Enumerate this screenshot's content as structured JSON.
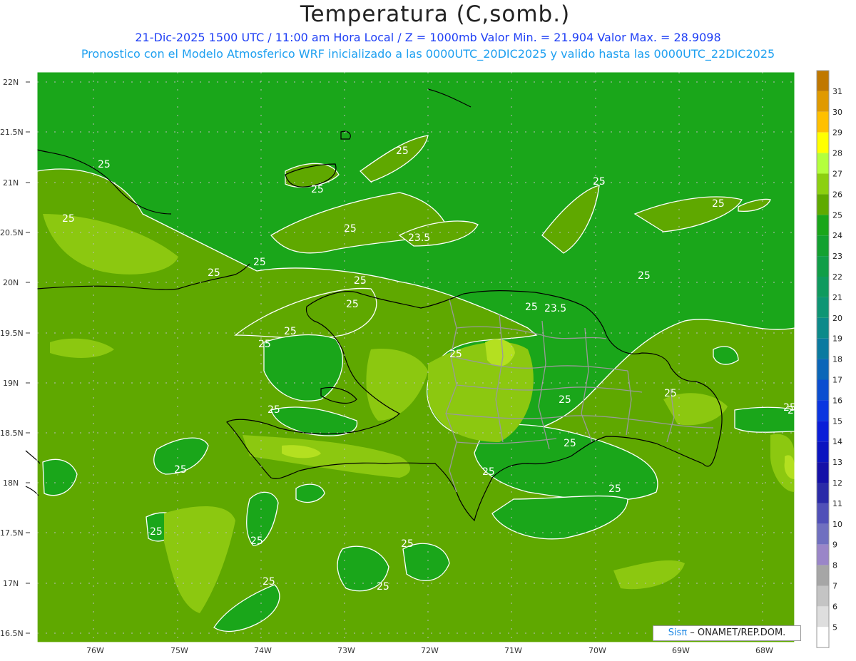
{
  "header": {
    "title": "Temperatura (C,somb.)",
    "line1": "21-Dic-2025 1500 UTC / 11:00 am Hora Local / Z = 1000mb   Valor Min. = 21.904  Valor Max. = 28.9098",
    "line2": "Pronostico con el Modelo Atmosferico WRF inicializado a las 0000UTC_20DIC2025 y valido hasta las  0000UTC_22DIC2025"
  },
  "map": {
    "lat_labels": [
      "22N",
      "21.5N",
      "21N",
      "20.5N",
      "20N",
      "19.5N",
      "19N",
      "18.5N",
      "18N",
      "17.5N",
      "17N",
      "16.5N"
    ],
    "lon_labels": [
      "76W",
      "75W",
      "74W",
      "73W",
      "72W",
      "71W",
      "70W",
      "69W",
      "68W"
    ],
    "contour_labels": [
      "25",
      "25",
      "25",
      "25",
      "25",
      "25",
      "25",
      "25",
      "25",
      "25",
      "25",
      "25",
      "23.5",
      "23.5",
      "25",
      "25",
      "25",
      "25",
      "25",
      "25",
      "25",
      "25",
      "25",
      "25",
      "25",
      "25",
      "25",
      "25",
      "25",
      "25",
      "25",
      "25"
    ],
    "colors": {
      "c24": "#1aa61a",
      "c25": "#5fa800",
      "c26": "#8cc810",
      "c27": "#a8d818",
      "coast": "#000000",
      "border": "#9a9a9a",
      "contour": "#ffffff"
    }
  },
  "colorbar": {
    "ticks": [
      "31",
      "30",
      "29",
      "28",
      "27",
      "26",
      "25",
      "24",
      "23",
      "22",
      "21",
      "20",
      "19",
      "18",
      "17",
      "16",
      "15",
      "14",
      "13",
      "12",
      "11",
      "10",
      "9",
      "8",
      "7",
      "6",
      "5"
    ],
    "colors": [
      "#c07800",
      "#e09a00",
      "#ffc000",
      "#ffff00",
      "#b4ff3c",
      "#8cd010",
      "#5faa00",
      "#1aa61a",
      "#13a130",
      "#109e48",
      "#0f9a5e",
      "#0e9574",
      "#0c8a8a",
      "#0a7aa0",
      "#0a66b8",
      "#0a4ed0",
      "#0a35e0",
      "#0a1ed8",
      "#0a14c0",
      "#1410a8",
      "#2a2aa8",
      "#5050b8",
      "#7070c0",
      "#9a86c8",
      "#a6a6a6",
      "#c4c4c4",
      "#dedede",
      "#ffffff"
    ]
  },
  "footer": {
    "brand_sis": "Sisπ",
    "brand_rest": " – ONAMET/REP.DOM."
  }
}
